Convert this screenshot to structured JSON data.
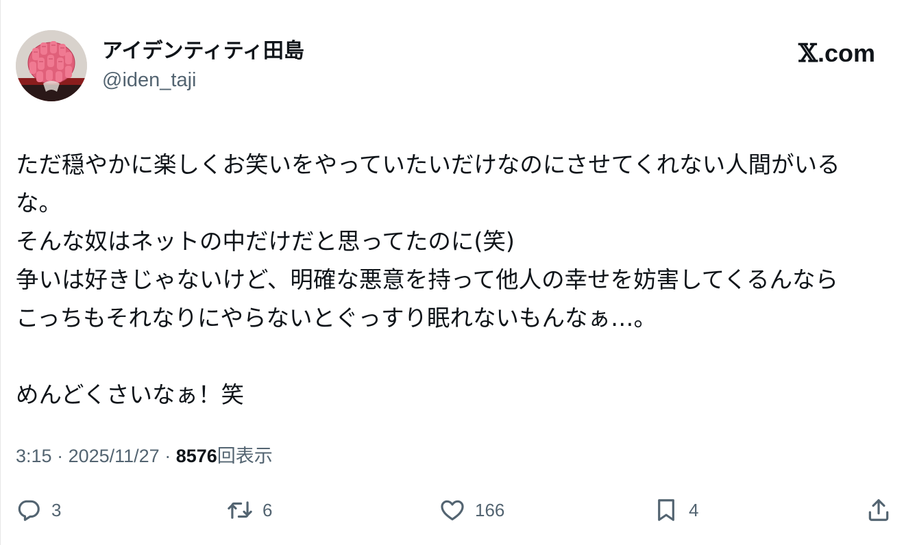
{
  "author": {
    "display_name": "アイデンティティ田島",
    "handle": "@iden_taji"
  },
  "brand": {
    "x_glyph": "𝕏",
    "suffix": ".com"
  },
  "tweet": {
    "lines": [
      "ただ穏やかに楽しくお笑いをやっていたいだけなのにさせてくれない人間がいる",
      "な。",
      "そんな奴はネットの中だけだと思ってたのに(笑)",
      "争いは好きじゃないけど、明確な悪意を持って他人の幸せを妨害してくるんなら",
      "こっちもそれなりにやらないとぐっすり眠れないもんなぁ…。",
      "",
      "めんどくさいなぁ！笑"
    ]
  },
  "meta": {
    "time": "3:15",
    "separator": " · ",
    "date": "2025/11/27",
    "views_count": "8576",
    "views_label": "回表示"
  },
  "actions": {
    "reply_icon": "reply-icon",
    "reply_count": "3",
    "repost_icon": "repost-icon",
    "repost_count": "6",
    "like_icon": "heart-icon",
    "like_count": "166",
    "bookmark_icon": "bookmark-icon",
    "bookmark_count": "4",
    "share_icon": "share-icon"
  },
  "colors": {
    "text_primary": "#0f1419",
    "text_secondary": "#536471",
    "background": "#ffffff"
  }
}
